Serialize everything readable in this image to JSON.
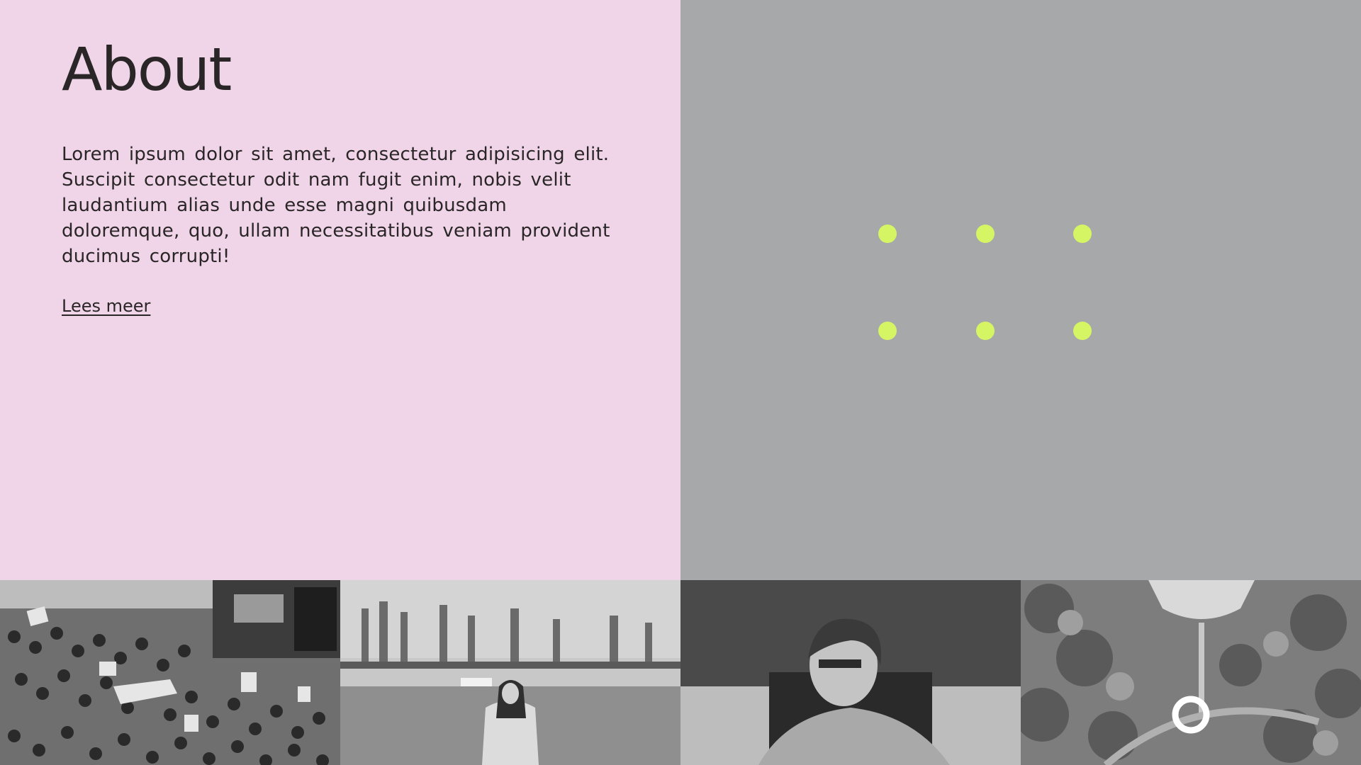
{
  "about": {
    "title": "About",
    "body": "Lorem ipsum dolor sit amet, consectetur adipisicing elit. Suscipit consectetur odit nam fugit enim, nobis velit laudantium alias unde esse magni quibusdam doloremque, quo, ullam necessitatibus veniam provident ducimus corrupti!",
    "read_more_label": "Lees meer"
  },
  "visual": {
    "dot_color": "#d6f564",
    "background": "#a7a8aa",
    "dots": 6
  },
  "image_strip": {
    "tiles": [
      "protest-crowd-photo",
      "woman-in-field-photo",
      "person-seated-photo",
      "aerial-park-photo"
    ],
    "style": "grayscale"
  }
}
